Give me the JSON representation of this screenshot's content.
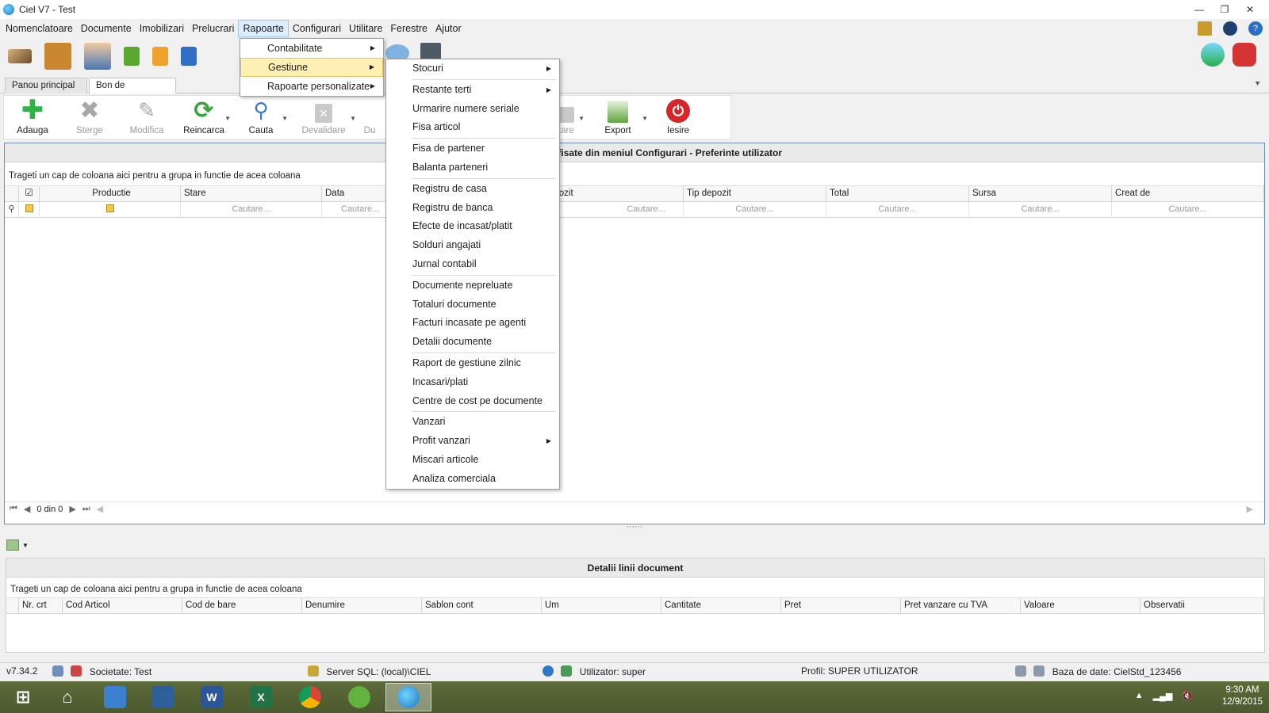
{
  "window": {
    "title": "Ciel V7 - Test",
    "controls": [
      "—",
      "❐",
      "✕"
    ]
  },
  "menubar": [
    "Nomenclatoare",
    "Documente",
    "Imobilizari",
    "Prelucrari",
    "Rapoarte",
    "Configurari",
    "Utilitare",
    "Ferestre",
    "Ajutor"
  ],
  "tabs": {
    "main": "Panou principal",
    "active": "Bon de consum",
    "close": "✕"
  },
  "ribbon": {
    "add": "Adauga",
    "delete": "Sterge",
    "edit": "Modifica",
    "reload": "Reincarca",
    "search": "Cauta",
    "invalidate": "Devalidare",
    "dup": "Du",
    "print": "stare",
    "export": "Export",
    "exit": "Iesire"
  },
  "grid": {
    "header": "numarul de zile afisate din meniul Configurari - Preferinte utilizator",
    "group_hint": "Trageti un cap de coloana aici pentru a grupa in functie de acea coloana",
    "columns": [
      "Productie",
      "Stare",
      "Data",
      "epozit",
      "Tip depozit",
      "Total",
      "Sursa",
      "Creat de"
    ],
    "filter_placeholder": "Cautare...",
    "pager": "0 din 0"
  },
  "details": {
    "header": "Detalii linii document",
    "group_hint": "Trageti un cap de coloana aici pentru a grupa in functie de acea coloana",
    "columns": [
      "Nr. crt",
      "Cod Articol",
      "Cod de bare",
      "Denumire",
      "Sablon cont",
      "Um",
      "Cantitate",
      "Pret",
      "Pret vanzare cu TVA",
      "Valoare",
      "Observatii"
    ]
  },
  "status": {
    "version": "v7.34.2",
    "company": "Societate: Test",
    "server": "Server SQL: (local)\\CIEL",
    "user": "Utilizator: super",
    "profile": "Profil: SUPER UTILIZATOR",
    "database": "Baza de date: CielStd_123456"
  },
  "taskbar": {
    "time": "9:30 AM",
    "date": "12/9/2015"
  },
  "rapoarte_menu": [
    {
      "label": "Contabilitate",
      "arrow": "▶"
    },
    {
      "label": "Gestiune",
      "arrow": "▶"
    },
    {
      "label": "Rapoarte personalizate",
      "arrow": "▶"
    }
  ],
  "gestiune_menu": {
    "g1": [
      {
        "label": "Stocuri",
        "arrow": "▶"
      }
    ],
    "g2": [
      {
        "label": "Restante terti",
        "arrow": "▶"
      },
      {
        "label": "Urmarire numere seriale"
      },
      {
        "label": "Fisa articol"
      }
    ],
    "g3": [
      {
        "label": "Fisa de partener"
      },
      {
        "label": "Balanta parteneri"
      }
    ],
    "g4": [
      {
        "label": "Registru de casa"
      },
      {
        "label": "Registru de banca"
      },
      {
        "label": "Efecte de incasat/platit"
      },
      {
        "label": "Solduri angajati"
      },
      {
        "label": "Jurnal contabil"
      }
    ],
    "g5": [
      {
        "label": "Documente nepreluate"
      },
      {
        "label": "Totaluri documente"
      },
      {
        "label": "Facturi incasate pe agenti"
      },
      {
        "label": "Detalii documente"
      }
    ],
    "g6": [
      {
        "label": "Raport de gestiune zilnic"
      },
      {
        "label": "Incasari/plati"
      },
      {
        "label": "Centre de cost pe documente"
      }
    ],
    "g7": [
      {
        "label": "Vanzari"
      },
      {
        "label": "Profit vanzari",
        "arrow": "▶"
      },
      {
        "label": "Miscari articole"
      },
      {
        "label": "Analiza comerciala"
      }
    ]
  },
  "colors": {
    "accent": "#6f8ab8",
    "highlight": "#fdf0b2",
    "add": "#2fb344",
    "exit": "#d7262a"
  }
}
